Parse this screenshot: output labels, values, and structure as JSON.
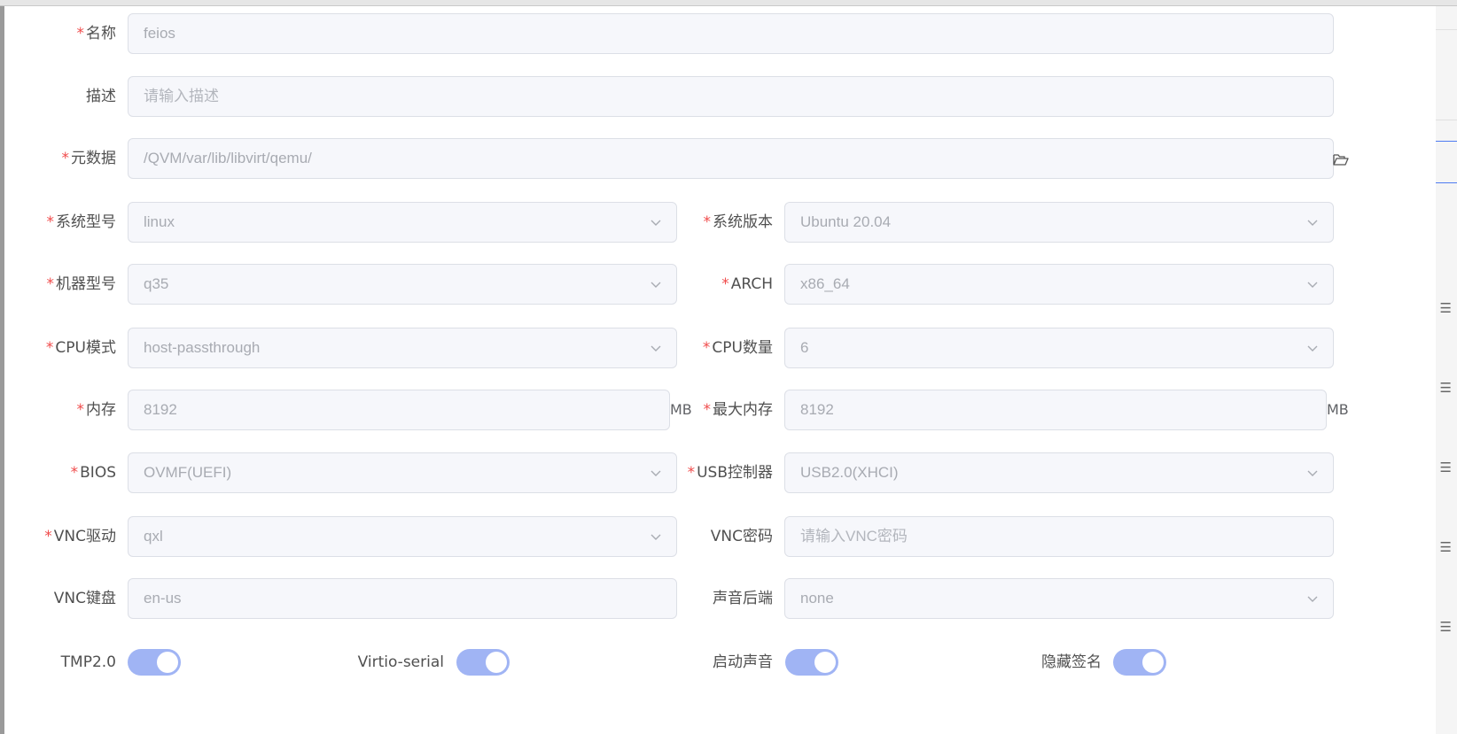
{
  "colors": {
    "required": "#f04b4b",
    "field_bg": "#f6f7fb",
    "switch_on": "#a0b4f4",
    "accent": "#4f7cf2"
  },
  "form": {
    "name": {
      "label": "名称",
      "required": true,
      "value": "feios"
    },
    "desc": {
      "label": "描述",
      "required": false,
      "placeholder": "请输入描述"
    },
    "metadata": {
      "label": "元数据",
      "required": true,
      "value": "/QVM/var/lib/libvirt/qemu/",
      "icon": "folder-open-icon"
    },
    "os_type": {
      "label": "系统型号",
      "required": true,
      "value": "linux"
    },
    "os_version": {
      "label": "系统版本",
      "required": true,
      "value": "Ubuntu 20.04"
    },
    "machine_type": {
      "label": "机器型号",
      "required": true,
      "value": "q35"
    },
    "arch": {
      "label": "ARCH",
      "required": true,
      "value": "x86_64"
    },
    "cpu_mode": {
      "label": "CPU模式",
      "required": true,
      "value": "host-passthrough"
    },
    "cpu_count": {
      "label": "CPU数量",
      "required": true,
      "value": "6"
    },
    "memory": {
      "label": "内存",
      "required": true,
      "value": "8192",
      "unit": "MB"
    },
    "max_memory": {
      "label": "最大内存",
      "required": true,
      "value": "8192",
      "unit": "MB"
    },
    "bios": {
      "label": "BIOS",
      "required": true,
      "value": "OVMF(UEFI)"
    },
    "usb_controller": {
      "label": "USB控制器",
      "required": true,
      "value": "USB2.0(XHCI)"
    },
    "vnc_driver": {
      "label": "VNC驱动",
      "required": true,
      "value": "qxl"
    },
    "vnc_password": {
      "label": "VNC密码",
      "required": false,
      "placeholder": "请输入VNC密码"
    },
    "vnc_keyboard": {
      "label": "VNC键盘",
      "required": false,
      "value": "en-us"
    },
    "audio_backend": {
      "label": "声音后端",
      "required": false,
      "value": "none"
    },
    "toggles": [
      {
        "label": "TMP2.0",
        "on": true
      },
      {
        "label": "Virtio-serial",
        "on": true
      },
      {
        "label": "启动声音",
        "on": true
      },
      {
        "label": "隐藏签名",
        "on": true
      }
    ]
  }
}
